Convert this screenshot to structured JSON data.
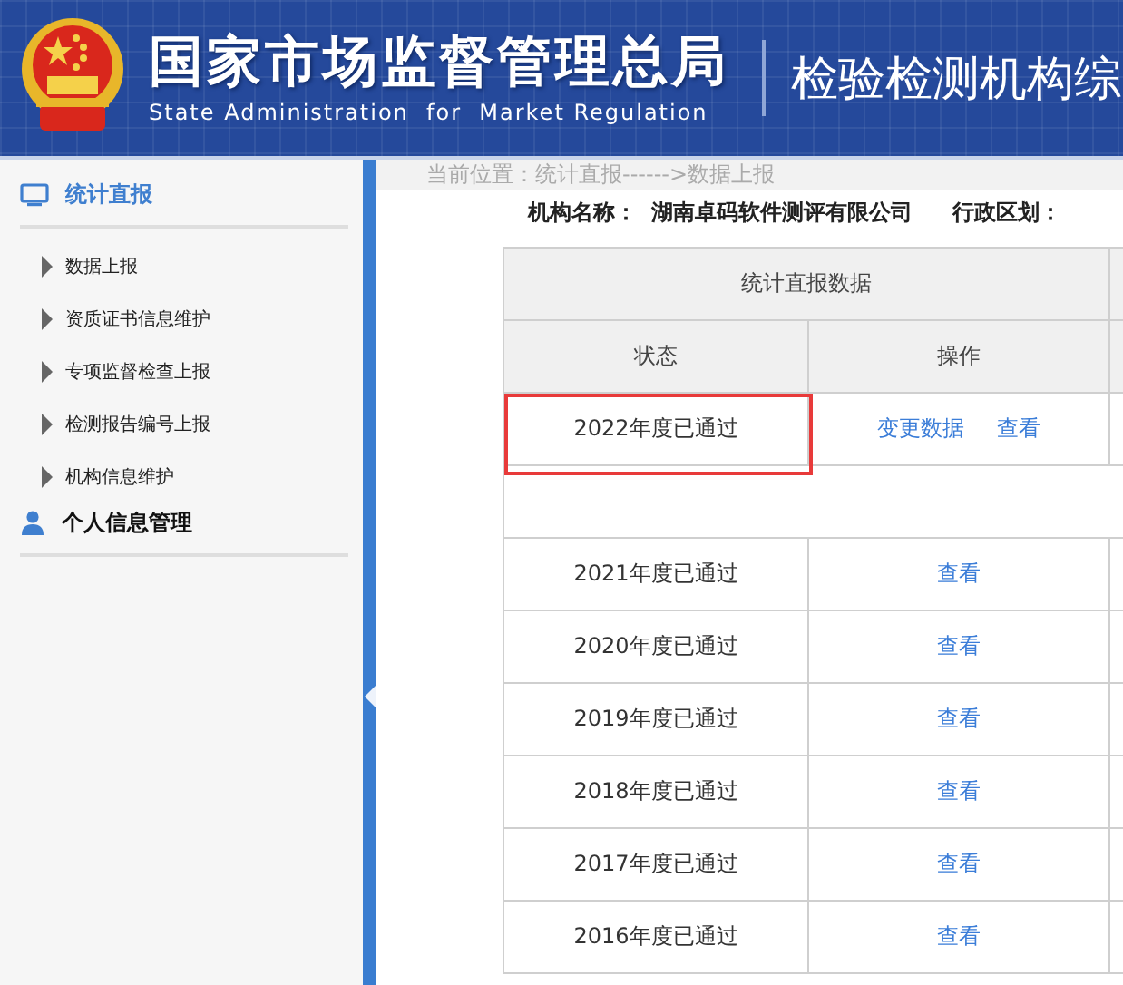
{
  "header": {
    "title": "国家市场监督管理总局",
    "title_en": "State Administration  for  Market Regulation",
    "subtitle": "检验检测机构综"
  },
  "sidebar": {
    "sections": [
      {
        "label": "统计直报",
        "kind": "monitor",
        "selected": true,
        "items": [
          "数据上报",
          "资质证书信息维护",
          "专项监督检查上报",
          "检测报告编号上报",
          "机构信息维护"
        ]
      },
      {
        "label": "个人信息管理",
        "kind": "person",
        "selected": false
      }
    ]
  },
  "breadcrumb": "当前位置：统计直报------>数据上报",
  "org": {
    "name_label": "机构名称：",
    "name": "湖南卓码软件测评有限公司",
    "region_label": "行政区划："
  },
  "table": {
    "group_header": "统计直报数据",
    "columns": [
      "状态",
      "操作"
    ],
    "rows": [
      {
        "kind": "record",
        "status": "2022年度已通过",
        "highlighted": true,
        "actions": [
          "变更数据",
          "查看"
        ]
      },
      {
        "kind": "blank"
      },
      {
        "kind": "record",
        "status": "2021年度已通过",
        "highlighted": false,
        "actions": [
          "查看"
        ]
      },
      {
        "kind": "record",
        "status": "2020年度已通过",
        "highlighted": false,
        "actions": [
          "查看"
        ]
      },
      {
        "kind": "record",
        "status": "2019年度已通过",
        "highlighted": false,
        "actions": [
          "查看"
        ]
      },
      {
        "kind": "record",
        "status": "2018年度已通过",
        "highlighted": false,
        "actions": [
          "查看"
        ]
      },
      {
        "kind": "record",
        "status": "2017年度已通过",
        "highlighted": false,
        "actions": [
          "查看"
        ]
      },
      {
        "kind": "record",
        "status": "2016年度已通过",
        "highlighted": false,
        "actions": [
          "查看"
        ]
      }
    ]
  }
}
